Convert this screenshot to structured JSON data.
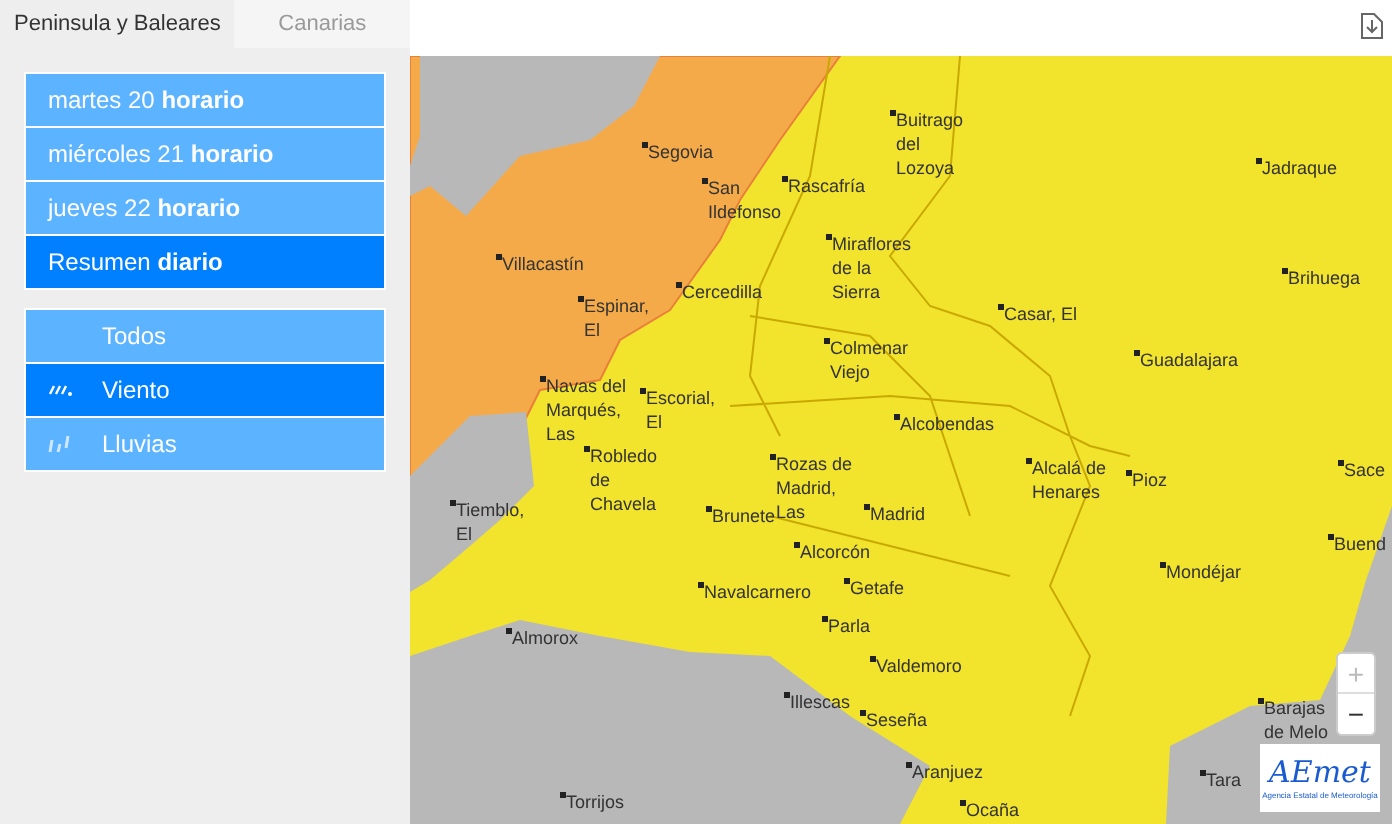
{
  "tabs": [
    {
      "label": "Peninsula y Baleares",
      "selected": true
    },
    {
      "label": "Canarias",
      "selected": false
    }
  ],
  "days": [
    {
      "label": "martes 20 **horario**",
      "selected": false
    },
    {
      "label": "miércoles 21 **horario**",
      "selected": false
    },
    {
      "label": "jueves 22 **horario**",
      "selected": false
    },
    {
      "label": "Resumen **diario**",
      "selected": true
    }
  ],
  "phenomena": [
    {
      "label": "Todos",
      "kind": "all",
      "selected": false
    },
    {
      "label": "Viento",
      "kind": "wind",
      "selected": true
    },
    {
      "label": "Lluvias",
      "kind": "rain",
      "selected": false
    }
  ],
  "map": {
    "towns": [
      {
        "name": "Segovia"
      },
      {
        "name": "San\nIldefonso"
      },
      {
        "name": "Rascafría"
      },
      {
        "name": "Buitrago\ndel\nLozoya"
      },
      {
        "name": "Jadraque"
      },
      {
        "name": "Villacastín"
      },
      {
        "name": "Cercedilla"
      },
      {
        "name": "Miraflores\nde la\nSierra"
      },
      {
        "name": "Brihuega"
      },
      {
        "name": "Espinar,\nEl"
      },
      {
        "name": "Casar, El"
      },
      {
        "name": "Colmenar\nViejo"
      },
      {
        "name": "Guadalajara"
      },
      {
        "name": "Navas del\nMarqués,\nLas"
      },
      {
        "name": "Escorial,\nEl"
      },
      {
        "name": "Alcobendas"
      },
      {
        "name": "Robledo\nde\nChavela"
      },
      {
        "name": "Rozas de\nMadrid,\nLas"
      },
      {
        "name": "Alcalá de\nHenares"
      },
      {
        "name": "Pioz"
      },
      {
        "name": "Sace"
      },
      {
        "name": "Tiemblo,\nEl"
      },
      {
        "name": "Brunete"
      },
      {
        "name": "Madrid"
      },
      {
        "name": "Buend"
      },
      {
        "name": "Alcorcón"
      },
      {
        "name": "Getafe"
      },
      {
        "name": "Mondéjar"
      },
      {
        "name": "Navalcarnero"
      },
      {
        "name": "Almorox"
      },
      {
        "name": "Parla"
      },
      {
        "name": "Valdemoro"
      },
      {
        "name": "Illescas"
      },
      {
        "name": "Seseña"
      },
      {
        "name": "Barajas\nde Melo"
      },
      {
        "name": "Tara"
      },
      {
        "name": "Aranjuez"
      },
      {
        "name": "Torrijos"
      },
      {
        "name": "Ocaña"
      }
    ],
    "zoom_in": "+",
    "zoom_out": "−",
    "logo_text": "AEmet",
    "logo_caption": "Agencia Estatal de Meteorología"
  }
}
